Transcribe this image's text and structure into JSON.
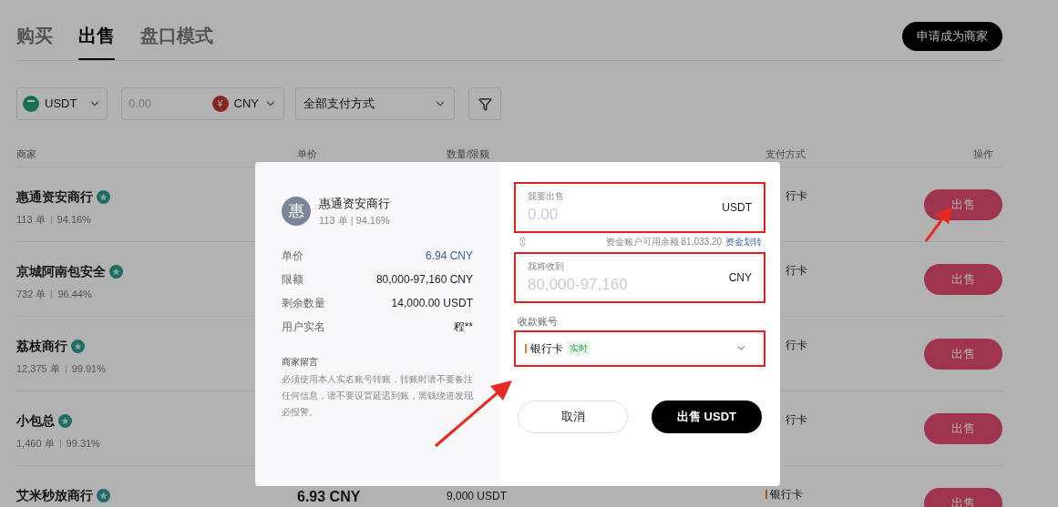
{
  "tabs": [
    {
      "label": "购买",
      "selected": false
    },
    {
      "label": "出售",
      "selected": true
    },
    {
      "label": "盘口模式",
      "selected": false
    }
  ],
  "apply_button": "申请成为商家",
  "filters": {
    "crypto": "USDT",
    "amount_placeholder": "0.00",
    "fiat": "CNY",
    "fiat_symbol": "¥",
    "payment": "全部支付方式"
  },
  "table": {
    "columns": [
      "商家",
      "单价",
      "数量/限额",
      "支付方式",
      "操作"
    ],
    "rows": [
      {
        "name": "惠通资安商行",
        "verified": true,
        "orders": "113 单",
        "rate": "94.16%",
        "pay": "行卡",
        "pay_marker": false,
        "action": "出售"
      },
      {
        "name": "京城阿南包安全",
        "verified": true,
        "orders": "732 单",
        "rate": "96.44%",
        "pay": "行卡",
        "pay_marker": false,
        "action": "出售"
      },
      {
        "name": "荔枝商行",
        "verified": true,
        "orders": "12,375 单",
        "rate": "99.91%",
        "pay": "行卡",
        "pay_marker": false,
        "action": "出售"
      },
      {
        "name": "小包总",
        "verified": true,
        "orders": "1,460 单",
        "rate": "99.31%",
        "pay": "行卡",
        "pay_marker": false,
        "action": "出售"
      },
      {
        "name": "艾米秒放商行",
        "verified": true,
        "price": "6.93 CNY",
        "quantity": "9,000 USDT",
        "pay": "银行卡",
        "pay_marker": true,
        "action": "出售"
      }
    ]
  },
  "dialog": {
    "avatar": "惠",
    "merchant": "惠通资安商行",
    "stats": "113 单 | 94.16%",
    "details": [
      {
        "label": "单价",
        "value": "6.94 CNY",
        "accent": true
      },
      {
        "label": "限额",
        "value": "80,000-97,160 CNY",
        "accent": false
      },
      {
        "label": "剩余数量",
        "value": "14,000.00 USDT",
        "accent": false
      },
      {
        "label": "用户实名",
        "value": "程**",
        "accent": false
      }
    ],
    "note_title": "商家留言",
    "note": "必须使用本人实名账号转账，转账时请不要备注任何信息，请不要设置延迟到账，黑钱绕道发现必报警。",
    "sell_field": {
      "label": "我要出售",
      "placeholder": "0.00",
      "unit": "USDT"
    },
    "balance": "资金账户可用余额 81,033.20",
    "transfer_link": "资金划转",
    "receive_field": {
      "label": "我将收到",
      "placeholder": "80,000-97,160",
      "unit": "CNY"
    },
    "account_label": "收款账号",
    "account": {
      "value": "银行卡",
      "tag": "实时"
    },
    "cancel": "取消",
    "confirm": "出售 USDT"
  }
}
